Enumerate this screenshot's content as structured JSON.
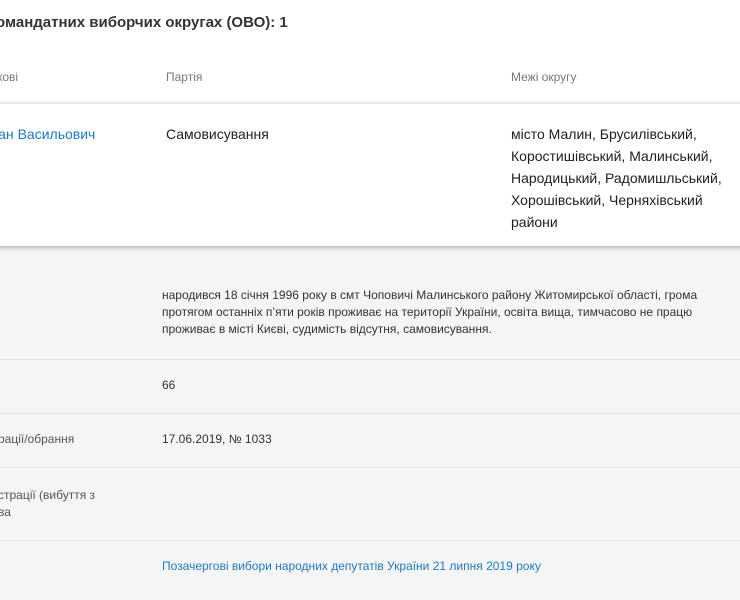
{
  "section": {
    "title": "омандатних виборчих округах (ОВО): 1"
  },
  "table": {
    "headers": [
      "кові",
      "Партія",
      "Межі округу"
    ],
    "row": {
      "name": "дан Васильович",
      "party": "Самовисування",
      "bounds": "місто Малин, Брусилівський, Коростишівський, Малинський, Народицький, Радомишльський, Хорошівський, Черняхівський райони"
    }
  },
  "details": {
    "bio_lines": [
      "народився 18 січня 1996 року в смт Чоповичі Малинського району Житомирської області, грома",
      "протягом останніх п’яти років проживає на території України, освіта вища, тимчасово не працю",
      "проживає в місті Києві, судимість відсутня, самовисування."
    ],
    "number": "66",
    "registration_label": "рації/обрання",
    "registration_value": "17.06.2019, № 1033",
    "dereg_label_line1": "страції (вибуття з",
    "dereg_label_line2": "ва",
    "election_link": "Позачергові вибори народних депутатів України 21 липня 2019 року"
  }
}
